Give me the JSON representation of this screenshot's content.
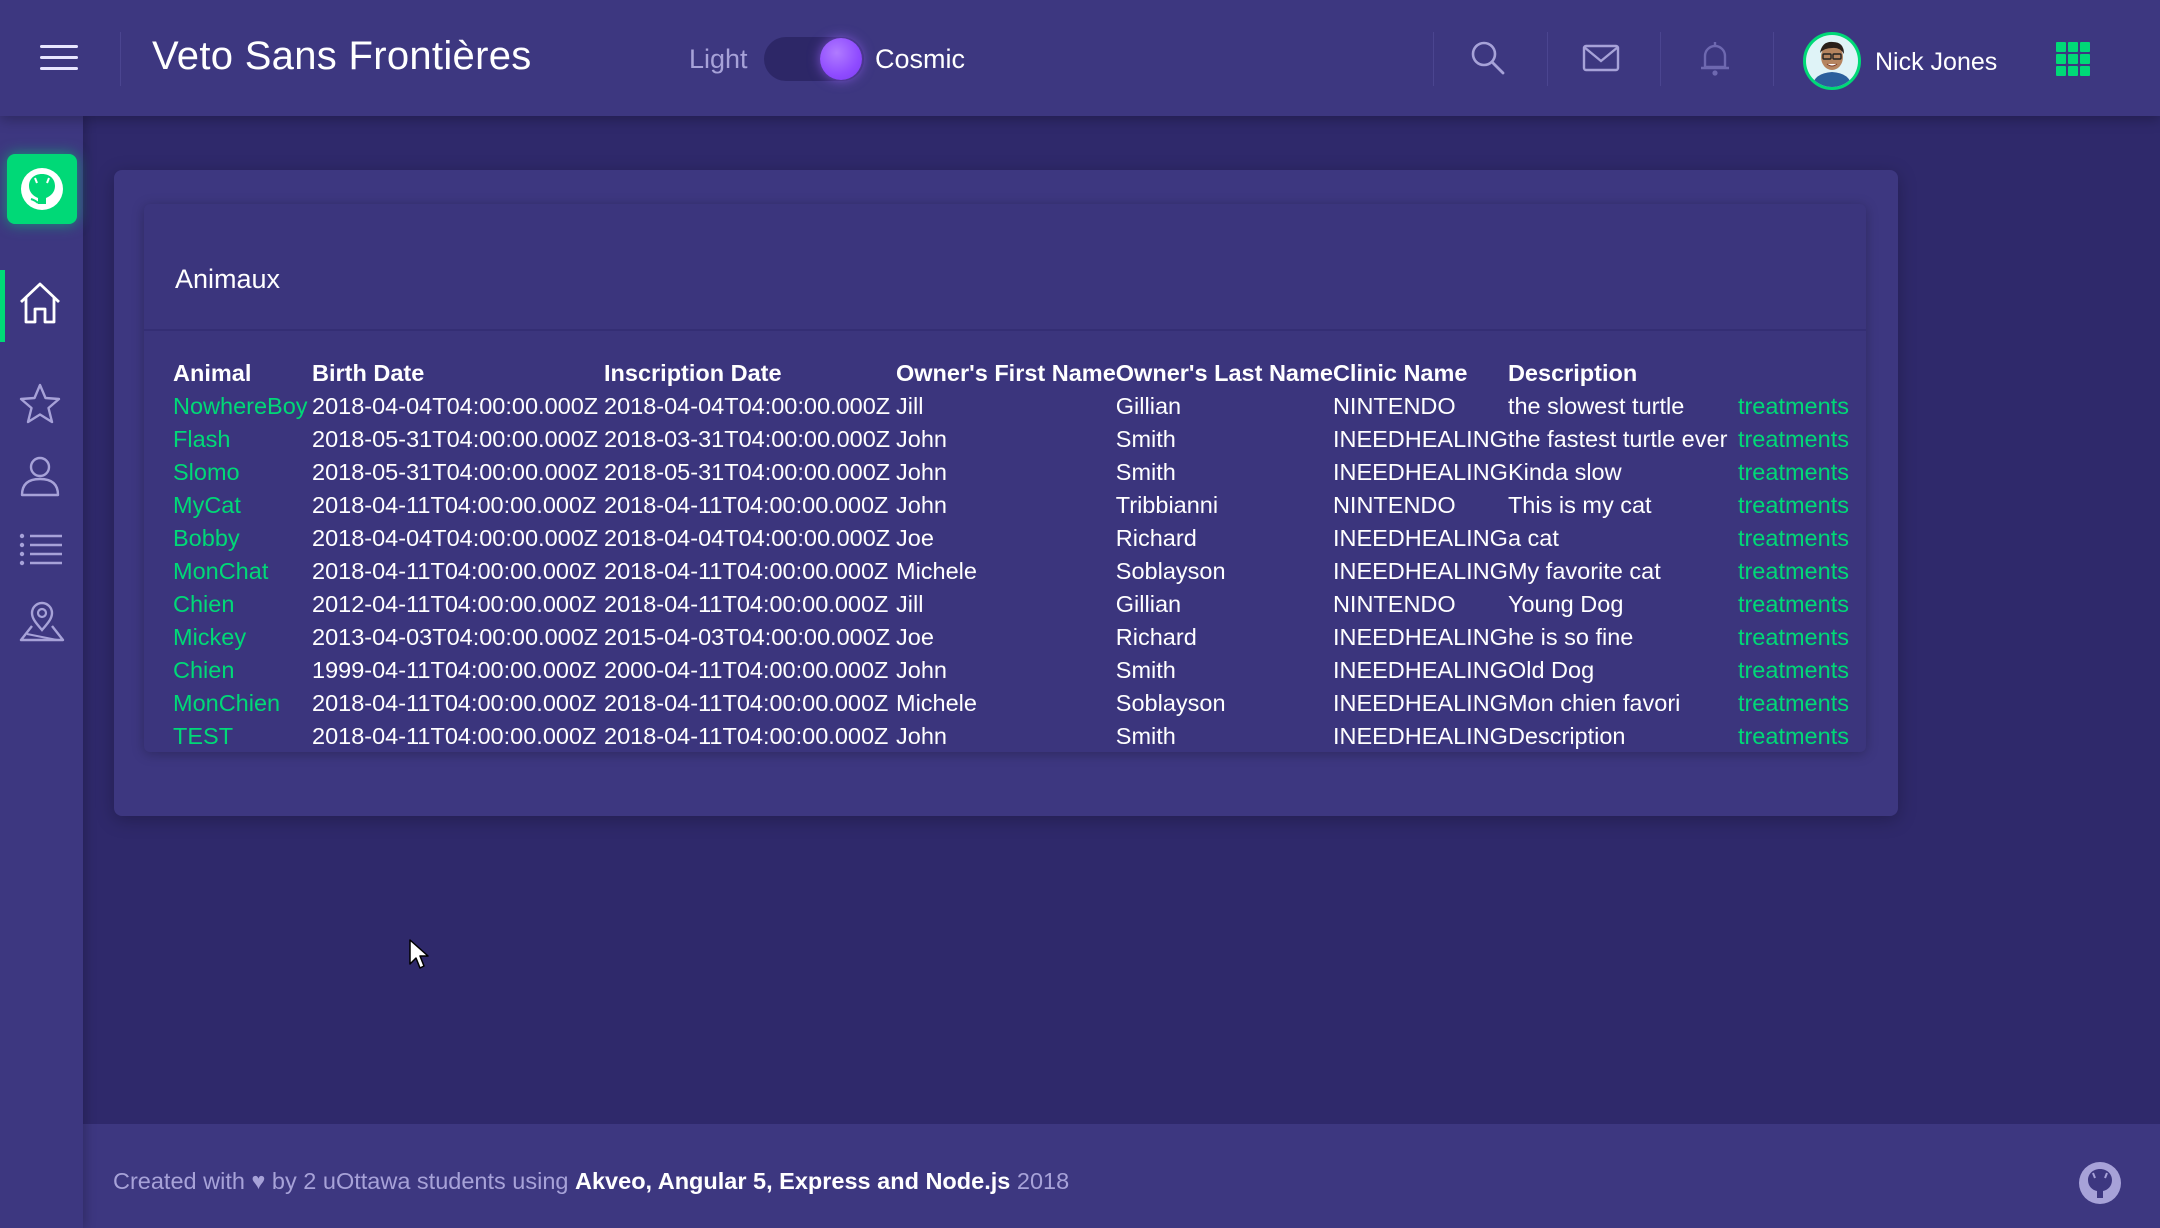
{
  "header": {
    "app_title": "Veto Sans Frontières",
    "theme_light_label": "Light",
    "theme_cosmic_label": "Cosmic",
    "user_name": "Nick Jones"
  },
  "sidebar": {
    "items": [
      "home",
      "favorites",
      "user",
      "list",
      "map"
    ],
    "active": "home"
  },
  "card": {
    "title": "Animaux",
    "columns": [
      "Animal",
      "Birth Date",
      "Inscription Date",
      "Owner's First Name",
      "Owner's Last Name",
      "Clinic Name",
      "Description",
      ""
    ],
    "rows": [
      {
        "animal": "NowhereBoy",
        "birth": "2018-04-04T04:00:00.000Z",
        "inscription": "2018-04-04T04:00:00.000Z",
        "first": "Jill",
        "last": "Gillian",
        "clinic": "NINTENDO",
        "description": "the slowest turtle",
        "link": "treatments"
      },
      {
        "animal": "Flash",
        "birth": "2018-05-31T04:00:00.000Z",
        "inscription": "2018-03-31T04:00:00.000Z",
        "first": "John",
        "last": "Smith",
        "clinic": "INEEDHEALING",
        "description": "the fastest turtle ever",
        "link": "treatments"
      },
      {
        "animal": "Slomo",
        "birth": "2018-05-31T04:00:00.000Z",
        "inscription": "2018-05-31T04:00:00.000Z",
        "first": "John",
        "last": "Smith",
        "clinic": "INEEDHEALING",
        "description": "Kinda slow",
        "link": "treatments"
      },
      {
        "animal": "MyCat",
        "birth": "2018-04-11T04:00:00.000Z",
        "inscription": "2018-04-11T04:00:00.000Z",
        "first": "John",
        "last": "Tribbianni",
        "clinic": "NINTENDO",
        "description": "This is my cat",
        "link": "treatments"
      },
      {
        "animal": "Bobby",
        "birth": "2018-04-04T04:00:00.000Z",
        "inscription": "2018-04-04T04:00:00.000Z",
        "first": "Joe",
        "last": "Richard",
        "clinic": "INEEDHEALING",
        "description": "a cat",
        "link": "treatments"
      },
      {
        "animal": "MonChat",
        "birth": "2018-04-11T04:00:00.000Z",
        "inscription": "2018-04-11T04:00:00.000Z",
        "first": "Michele",
        "last": "Soblayson",
        "clinic": "INEEDHEALING",
        "description": "My favorite cat",
        "link": "treatments"
      },
      {
        "animal": "Chien",
        "birth": "2012-04-11T04:00:00.000Z",
        "inscription": "2018-04-11T04:00:00.000Z",
        "first": "Jill",
        "last": "Gillian",
        "clinic": "NINTENDO",
        "description": "Young Dog",
        "link": "treatments"
      },
      {
        "animal": "Mickey",
        "birth": "2013-04-03T04:00:00.000Z",
        "inscription": "2015-04-03T04:00:00.000Z",
        "first": "Joe",
        "last": "Richard",
        "clinic": "INEEDHEALING",
        "description": "he is so fine",
        "link": "treatments"
      },
      {
        "animal": "Chien",
        "birth": "1999-04-11T04:00:00.000Z",
        "inscription": "2000-04-11T04:00:00.000Z",
        "first": "John",
        "last": "Smith",
        "clinic": "INEEDHEALING",
        "description": "Old Dog",
        "link": "treatments"
      },
      {
        "animal": "MonChien",
        "birth": "2018-04-11T04:00:00.000Z",
        "inscription": "2018-04-11T04:00:00.000Z",
        "first": "Michele",
        "last": "Soblayson",
        "clinic": "INEEDHEALING",
        "description": "Mon chien favori",
        "link": "treatments"
      },
      {
        "animal": "TEST",
        "birth": "2018-04-11T04:00:00.000Z",
        "inscription": "2018-04-11T04:00:00.000Z",
        "first": "John",
        "last": "Smith",
        "clinic": "INEEDHEALING",
        "description": "Description",
        "link": "treatments"
      }
    ]
  },
  "footer": {
    "prefix": "Created with ♥ by 2 uOttawa students using ",
    "tech": "Akveo, Angular 5, Express and Node.js",
    "year": " 2018"
  },
  "colors": {
    "background": "#2f296b",
    "surface": "#3d3780",
    "accent": "#00d977",
    "muted_text": "#a7a2d8"
  }
}
